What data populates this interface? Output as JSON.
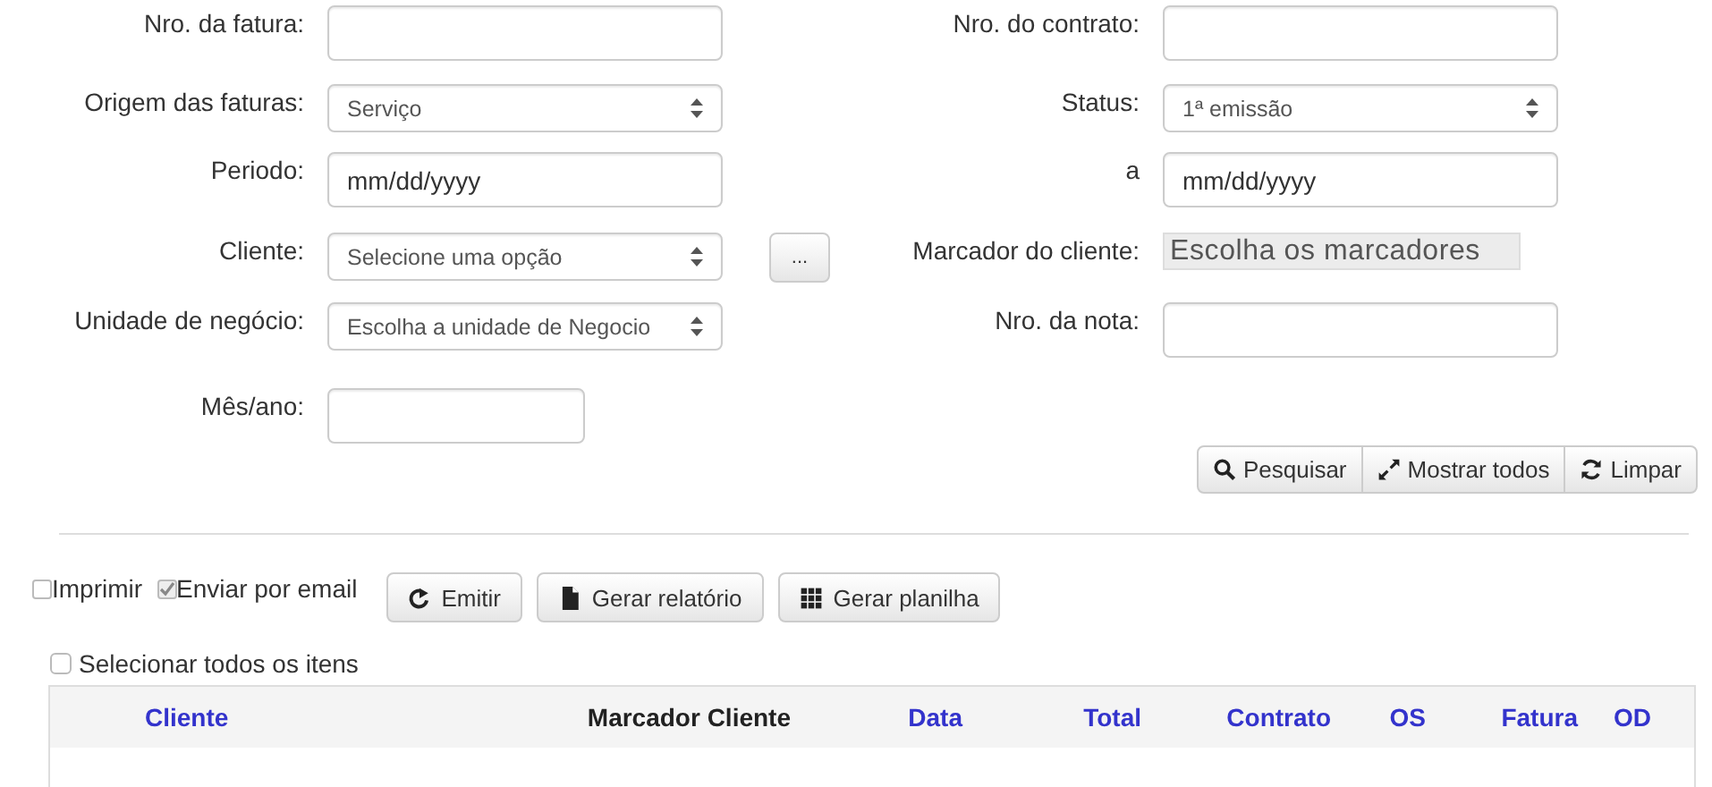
{
  "form": {
    "rows": [
      {
        "left": {
          "label": "Nro. da fatura:",
          "kind": "text"
        },
        "right": {
          "label": "Nro. do contrato:",
          "kind": "text"
        }
      },
      {
        "left": {
          "label": "Origem das faturas:",
          "kind": "select",
          "value": "Serviço"
        },
        "right": {
          "label": "Status:",
          "kind": "select",
          "value": "1ª emissão"
        }
      },
      {
        "left": {
          "label": "Periodo:",
          "kind": "date",
          "placeholder": "mm/dd/yyyy"
        },
        "right": {
          "label": "a",
          "kind": "date",
          "placeholder": "mm/dd/yyyy"
        }
      },
      {
        "left": {
          "label": "Cliente:",
          "kind": "select",
          "value": "Selecione uma opção",
          "extra_button": "..."
        },
        "right": {
          "label": "Marcador do cliente:",
          "kind": "tags",
          "placeholder": "Escolha os marcadores"
        }
      },
      {
        "left": {
          "label": "Unidade de negócio:",
          "kind": "select",
          "value": "Escolha a unidade de Negocio"
        },
        "right": {
          "label": "Nro. da nota:",
          "kind": "text"
        }
      },
      {
        "left": {
          "label": "Mês/ano:",
          "kind": "short"
        }
      }
    ]
  },
  "search_buttons": [
    {
      "label": "Pesquisar"
    },
    {
      "label": "Mostrar todos"
    },
    {
      "label": "Limpar"
    }
  ],
  "options": [
    {
      "label": "Imprimir",
      "checked": false
    },
    {
      "label": "Enviar por email",
      "checked": true
    }
  ],
  "action_buttons": [
    {
      "label": "Emitir"
    },
    {
      "label": "Gerar relatório"
    },
    {
      "label": "Gerar planilha"
    }
  ],
  "select_all": {
    "label": "Selecionar todos os itens",
    "checked": false
  },
  "table": {
    "columns": [
      {
        "label": "Cliente",
        "sortable": true
      },
      {
        "label": "Marcador Cliente",
        "sortable": false
      },
      {
        "label": "Data",
        "sortable": true
      },
      {
        "label": "Total",
        "sortable": true
      },
      {
        "label": "Contrato",
        "sortable": true
      },
      {
        "label": "OS",
        "sortable": true
      },
      {
        "label": "Fatura",
        "sortable": true
      },
      {
        "label": "OD",
        "sortable": true
      }
    ]
  }
}
